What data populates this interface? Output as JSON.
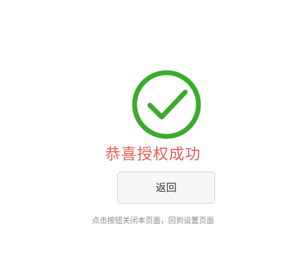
{
  "status": {
    "icon": "check-circle-icon",
    "icon_color": "#3bab2c",
    "title": "恭喜授权成功",
    "title_color": "#e85a5a"
  },
  "actions": {
    "back_label": "返回"
  },
  "hint": {
    "text": "点击按钮关闭本页面，回到设置页面"
  }
}
